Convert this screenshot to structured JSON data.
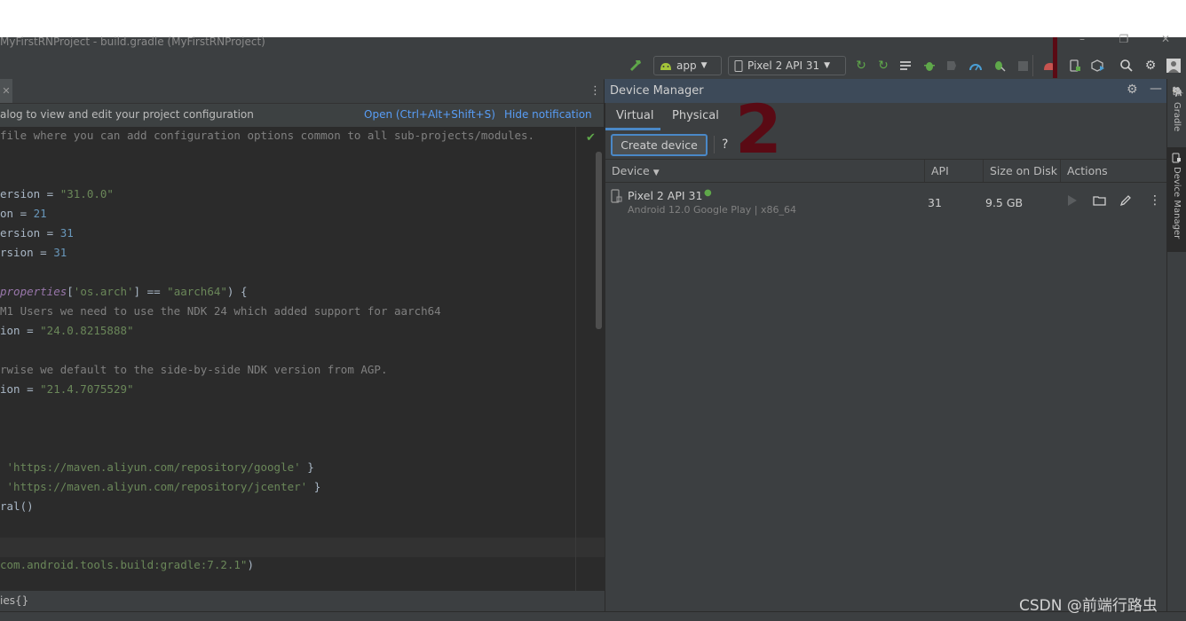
{
  "window": {
    "title": "MyFirstRNProject - build.gradle (MyFirstRNProject)",
    "minimize": "–",
    "restore": "❐",
    "close": "✕"
  },
  "toolbar": {
    "config_selector": "app",
    "device_selector": "Pixel 2 API 31"
  },
  "notification": {
    "text": "alog to view and edit your project configuration",
    "open_link": "Open (Ctrl+Alt+Shift+S)",
    "hide_link": "Hide notification"
  },
  "editor": {
    "lines": [
      [
        [
          "cmt",
          "file where you can add configuration options common to all sub-projects/modules."
        ]
      ],
      [],
      [],
      [
        [
          "p",
          "ersion = "
        ],
        [
          "str",
          "\"31.0.0\""
        ]
      ],
      [
        [
          "p",
          "on = "
        ],
        [
          "num",
          "21"
        ]
      ],
      [
        [
          "p",
          "ersion = "
        ],
        [
          "num",
          "31"
        ]
      ],
      [
        [
          "p",
          "rsion = "
        ],
        [
          "num",
          "31"
        ]
      ],
      [],
      [
        [
          "prop",
          "properties"
        ],
        [
          "p",
          "["
        ],
        [
          "str",
          "'os.arch'"
        ],
        [
          "p",
          "] == "
        ],
        [
          "str",
          "\"aarch64\""
        ],
        [
          "p",
          ") {"
        ]
      ],
      [
        [
          "cmt",
          "M1 Users we need to use the NDK 24 which added support for aarch64"
        ]
      ],
      [
        [
          "p",
          "ion = "
        ],
        [
          "str",
          "\"24.0.8215888\""
        ]
      ],
      [],
      [
        [
          "cmt",
          "rwise we default to the side-by-side NDK version from AGP."
        ]
      ],
      [
        [
          "p",
          "ion = "
        ],
        [
          "str",
          "\"21.4.7075529\""
        ]
      ],
      [],
      [],
      [],
      [
        [
          "p",
          " "
        ],
        [
          "str",
          "'https://maven.aliyun.com/repository/google'"
        ],
        [
          "p",
          " }"
        ]
      ],
      [
        [
          "p",
          " "
        ],
        [
          "str",
          "'https://maven.aliyun.com/repository/jcenter'"
        ],
        [
          "p",
          " }"
        ]
      ],
      [
        [
          "p",
          "ral()"
        ]
      ],
      [],
      [],
      [
        [
          "str",
          "com.android.tools.build:gradle:7.2.1\""
        ],
        [
          "p",
          ")"
        ]
      ]
    ],
    "breadcrumb": "ies{}"
  },
  "device_manager": {
    "title": "Device Manager",
    "tabs": [
      "Virtual",
      "Physical"
    ],
    "create_button": "Create device",
    "help": "?",
    "annotation_number": "2",
    "columns": [
      "Device",
      "API",
      "Size on Disk",
      "Actions"
    ],
    "devices": [
      {
        "name": "Pixel 2 API 31",
        "details": "Android 12.0 Google Play | x86_64",
        "api": "31",
        "size": "9.5 GB"
      }
    ]
  },
  "sidebar": {
    "gradle": "Gradle",
    "device_manager": "Device Manager"
  },
  "watermark": "CSDN @前端行路虫",
  "colors": {
    "accent_link": "#589df6",
    "string": "#6a8759",
    "number": "#6897bb",
    "comment": "#808080",
    "android_green": "#a4c639",
    "annotation": "#5a0a14"
  }
}
